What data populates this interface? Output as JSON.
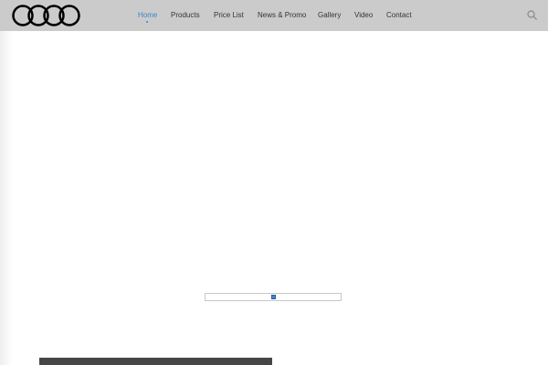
{
  "header": {
    "logo_icon": "four-rings-logo-icon",
    "background_color": "#cbcbcb"
  },
  "nav": {
    "items": [
      {
        "label": "Home",
        "active": true
      },
      {
        "label": "Products",
        "active": false
      },
      {
        "label": "Price List",
        "active": false
      },
      {
        "label": "News & Promo",
        "active": false
      },
      {
        "label": "Gallery",
        "active": false
      },
      {
        "label": "Video",
        "active": false
      },
      {
        "label": "Contact",
        "active": false
      }
    ],
    "active_color": "#3d86c6",
    "search_icon": "search-icon"
  },
  "slider": {
    "control_icon": "slider-handle-icon",
    "thumb_color": "#4a86c8"
  },
  "footer_panel": {
    "color": "#464646"
  }
}
